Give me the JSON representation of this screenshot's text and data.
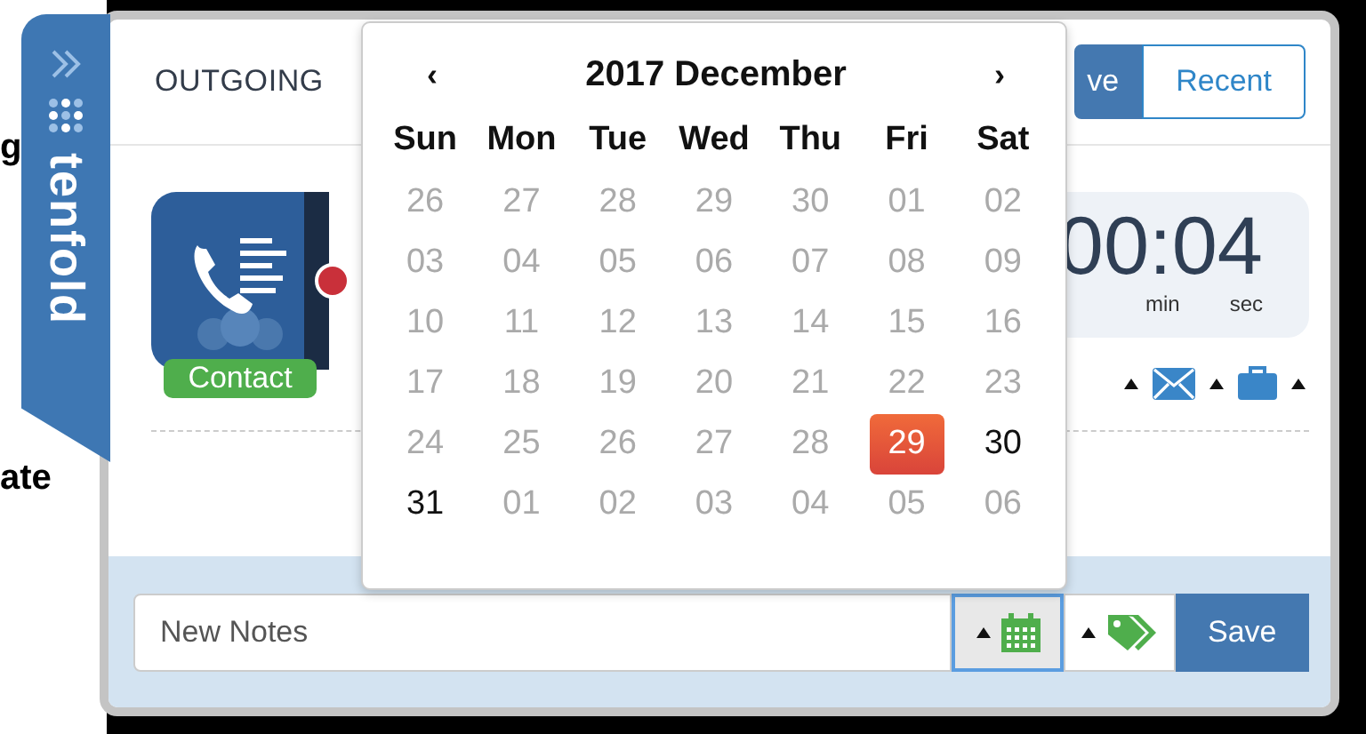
{
  "background_page": {
    "fragments": [
      "g",
      "ate"
    ]
  },
  "brand": {
    "name": "tenfold"
  },
  "header": {
    "title": "OUTGOING",
    "tabs": [
      {
        "label": "ve",
        "selected": true
      },
      {
        "label": "Recent",
        "selected": false
      }
    ]
  },
  "contact": {
    "badge": "Contact",
    "recording": true
  },
  "timer": {
    "value": "00:04",
    "units": [
      "min",
      "sec"
    ]
  },
  "actions": [
    {
      "kind": "email"
    },
    {
      "kind": "briefcase"
    }
  ],
  "calendar": {
    "prev": "‹",
    "next": "›",
    "title": "2017 December",
    "weekdays": [
      "Sun",
      "Mon",
      "Tue",
      "Wed",
      "Thu",
      "Fri",
      "Sat"
    ],
    "days": [
      {
        "label": "26",
        "disabled": true,
        "selected": false
      },
      {
        "label": "27",
        "disabled": true,
        "selected": false
      },
      {
        "label": "28",
        "disabled": true,
        "selected": false
      },
      {
        "label": "29",
        "disabled": true,
        "selected": false
      },
      {
        "label": "30",
        "disabled": true,
        "selected": false
      },
      {
        "label": "01",
        "disabled": true,
        "selected": false
      },
      {
        "label": "02",
        "disabled": true,
        "selected": false
      },
      {
        "label": "03",
        "disabled": true,
        "selected": false
      },
      {
        "label": "04",
        "disabled": true,
        "selected": false
      },
      {
        "label": "05",
        "disabled": true,
        "selected": false
      },
      {
        "label": "06",
        "disabled": true,
        "selected": false
      },
      {
        "label": "07",
        "disabled": true,
        "selected": false
      },
      {
        "label": "08",
        "disabled": true,
        "selected": false
      },
      {
        "label": "09",
        "disabled": true,
        "selected": false
      },
      {
        "label": "10",
        "disabled": true,
        "selected": false
      },
      {
        "label": "11",
        "disabled": true,
        "selected": false
      },
      {
        "label": "12",
        "disabled": true,
        "selected": false
      },
      {
        "label": "13",
        "disabled": true,
        "selected": false
      },
      {
        "label": "14",
        "disabled": true,
        "selected": false
      },
      {
        "label": "15",
        "disabled": true,
        "selected": false
      },
      {
        "label": "16",
        "disabled": true,
        "selected": false
      },
      {
        "label": "17",
        "disabled": true,
        "selected": false
      },
      {
        "label": "18",
        "disabled": true,
        "selected": false
      },
      {
        "label": "19",
        "disabled": true,
        "selected": false
      },
      {
        "label": "20",
        "disabled": true,
        "selected": false
      },
      {
        "label": "21",
        "disabled": true,
        "selected": false
      },
      {
        "label": "22",
        "disabled": true,
        "selected": false
      },
      {
        "label": "23",
        "disabled": true,
        "selected": false
      },
      {
        "label": "24",
        "disabled": true,
        "selected": false
      },
      {
        "label": "25",
        "disabled": true,
        "selected": false
      },
      {
        "label": "26",
        "disabled": true,
        "selected": false
      },
      {
        "label": "27",
        "disabled": true,
        "selected": false
      },
      {
        "label": "28",
        "disabled": true,
        "selected": false
      },
      {
        "label": "29",
        "disabled": false,
        "selected": true
      },
      {
        "label": "30",
        "disabled": false,
        "selected": false
      },
      {
        "label": "31",
        "disabled": false,
        "selected": false
      },
      {
        "label": "01",
        "disabled": true,
        "selected": false
      },
      {
        "label": "02",
        "disabled": true,
        "selected": false
      },
      {
        "label": "03",
        "disabled": true,
        "selected": false
      },
      {
        "label": "04",
        "disabled": true,
        "selected": false
      },
      {
        "label": "05",
        "disabled": true,
        "selected": false
      },
      {
        "label": "06",
        "disabled": true,
        "selected": false
      }
    ]
  },
  "notes": {
    "placeholder": "New Notes",
    "calendar_focused": true,
    "save": "Save"
  }
}
